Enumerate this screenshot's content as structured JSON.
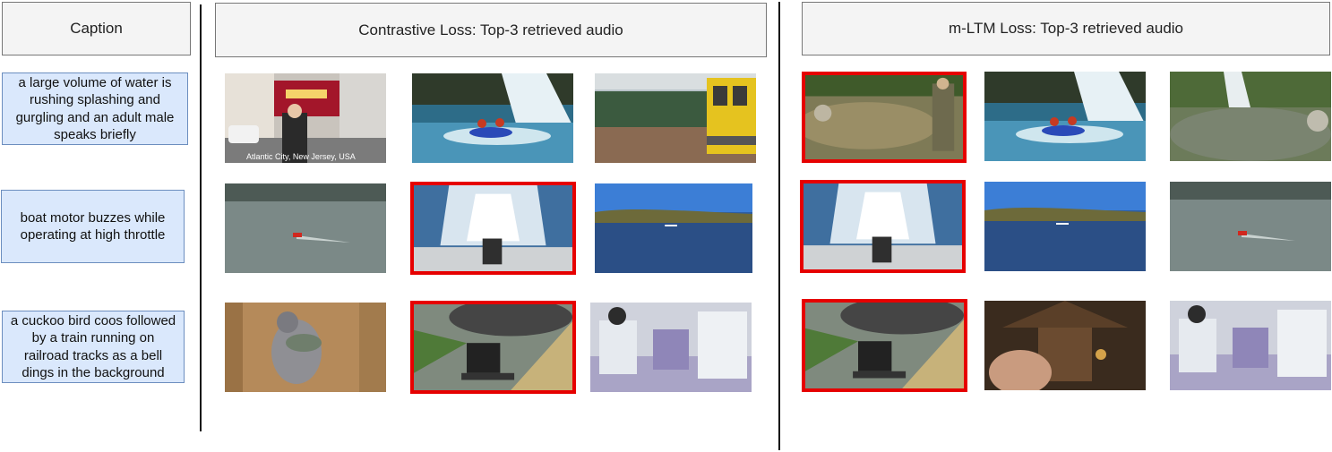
{
  "headers": {
    "caption": "Caption",
    "contrastive": "Contrastive Loss: Top-3 retrieved audio",
    "mltm": "m-LTM Loss: Top-3 retrieved audio"
  },
  "captions": [
    "a large volume of water is rushing splashing and gurgling and an adult male speaks briefly",
    "boat motor buzzes while operating at high throttle",
    "a cuckoo bird coos followed by a train running on railroad tracks as a bell dings in the background"
  ],
  "contrastive_results": [
    [
      {
        "scene": "city-street-thumbnail",
        "highlighted": false,
        "overlay_text": "Atlantic City, New Jersey, USA"
      },
      {
        "scene": "whitewater-raft-thumbnail",
        "highlighted": false
      },
      {
        "scene": "train-station-thumbnail",
        "highlighted": false
      }
    ],
    [
      {
        "scene": "rc-boat-thumbnail",
        "highlighted": false
      },
      {
        "scene": "boat-wake-thumbnail",
        "highlighted": true
      },
      {
        "scene": "lake-shore-thumbnail",
        "highlighted": false
      }
    ],
    [
      {
        "scene": "pigeon-thumbnail",
        "highlighted": false
      },
      {
        "scene": "steam-train-thumbnail",
        "highlighted": true
      },
      {
        "scene": "students-thumbnail",
        "highlighted": false
      }
    ]
  ],
  "mltm_results": [
    [
      {
        "scene": "river-hiker-thumbnail",
        "highlighted": true
      },
      {
        "scene": "whitewater-raft-thumbnail",
        "highlighted": false
      },
      {
        "scene": "waterfall-pool-thumbnail",
        "highlighted": false
      }
    ],
    [
      {
        "scene": "boat-wake-thumbnail",
        "highlighted": true
      },
      {
        "scene": "lake-shore-thumbnail",
        "highlighted": false
      },
      {
        "scene": "rc-boat-thumbnail",
        "highlighted": false
      }
    ],
    [
      {
        "scene": "steam-train-thumbnail",
        "highlighted": true
      },
      {
        "scene": "cuckoo-clock-thumbnail",
        "highlighted": false
      },
      {
        "scene": "students-thumbnail",
        "highlighted": false
      }
    ]
  ],
  "colors": {
    "highlight_border": "#e60000",
    "caption_fill": "#dae8fc",
    "caption_border": "#6c8ebf",
    "header_fill": "#f4f4f4"
  }
}
